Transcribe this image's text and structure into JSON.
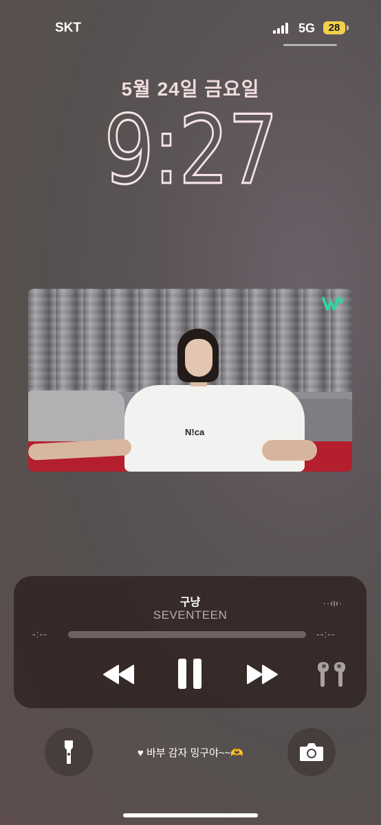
{
  "status_bar": {
    "carrier": "SKT",
    "network": "5G",
    "battery": "28",
    "signal_icon": "cellular-signal-icon",
    "battery_color": "#f2d04a"
  },
  "lock_screen": {
    "date": "5월 24일 금요일",
    "time": "9:27",
    "time_color": "#f6e4e6"
  },
  "media_widget": {
    "shirt_text": "N!ca",
    "logo_icon": "weverse-logo-icon",
    "logo_color": "#2fd6a1"
  },
  "now_playing": {
    "title": "구냥",
    "artist": "SEVENTEEN",
    "elapsed": "-:--",
    "remaining": "--:--",
    "controls": [
      "rewind-icon",
      "pause-icon",
      "fast-forward-icon",
      "airpods-pro-icon"
    ]
  },
  "bottom": {
    "lock_message": "♥ 바부 감자 밍구야~~🫶",
    "flashlight_icon": "flashlight-icon",
    "camera_icon": "camera-icon"
  }
}
